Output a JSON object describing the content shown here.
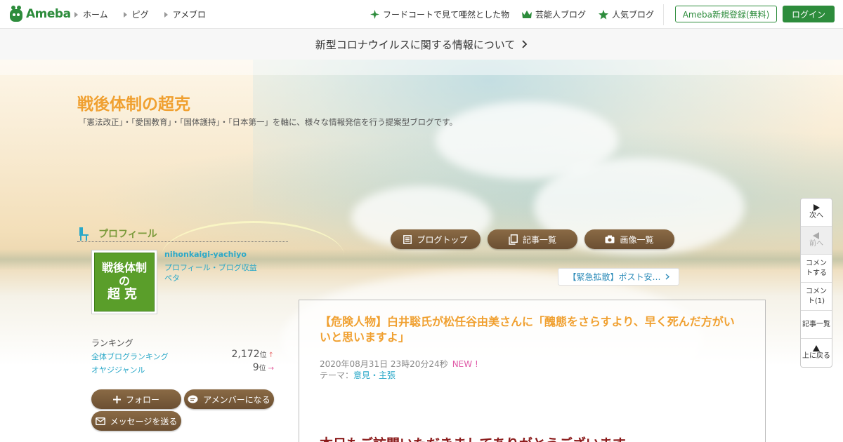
{
  "header": {
    "logo_text": "Ameba",
    "nav_left": [
      {
        "label": "ホーム"
      },
      {
        "label": "ピグ"
      },
      {
        "label": "アメブロ"
      }
    ],
    "nav_right": [
      {
        "label": "フードコートで見て唖然とした物",
        "icon": "sparkle-icon"
      },
      {
        "label": "芸能人ブログ",
        "icon": "crown-icon"
      },
      {
        "label": "人気ブログ",
        "icon": "star-icon"
      }
    ],
    "register_label": "Ameba新規登録(無料)",
    "login_label": "ログイン"
  },
  "notice": {
    "text": "新型コロナウイルスに関する情報について"
  },
  "blog": {
    "title": "戦後体制の超克",
    "description": "「憲法改正」・「愛国教育」・「国体護持」・「日本第一」を軸に、様々な情報発信を行う提案型ブログです。"
  },
  "profile": {
    "heading": "プロフィール",
    "avatar_lines": [
      "戦後体制",
      "の",
      "超克"
    ],
    "username": "nihonkaigi-yachiyo",
    "link1": "プロフィール・ブログ収益",
    "link2": "ペタ"
  },
  "ranking": {
    "title": "ランキング",
    "rows": [
      {
        "label": "全体ブログランキング",
        "value": "2,172",
        "unit": "位",
        "trend": "↑"
      },
      {
        "label": "オヤジジャンル",
        "value": "9",
        "unit": "位",
        "trend": "→"
      }
    ]
  },
  "profile_buttons": {
    "follow": "フォロー",
    "member": "アメンバーになる",
    "message": "メッセージを送る"
  },
  "blog_nav": {
    "top": "ブログトップ",
    "list": "記事一覧",
    "images": "画像一覧"
  },
  "related": {
    "label": "【緊急拡散】ポスト安…"
  },
  "entry": {
    "title": "【危険人物】白井聡氏が松任谷由美さんに「醜態をさらすより、早く死んだ方がいいと思いますよ」",
    "date": "2020年08月31日 23時20分24秒",
    "new_badge": "NEW !",
    "theme_prefix": "テーマ：",
    "theme": "意見・主張",
    "body_start": "本日もご訪問いただきましてありがとうございます。"
  },
  "float_nav": [
    {
      "label": "次へ",
      "icon": "play-right-icon"
    },
    {
      "label": "前へ",
      "icon": "play-left-icon",
      "disabled": true
    },
    {
      "label": "コメントする"
    },
    {
      "label": "コメント(1)"
    },
    {
      "label": "記事一覧"
    },
    {
      "label": "上に戻る",
      "icon": "triangle-up-icon"
    }
  ],
  "colors": {
    "brand_green": "#2d8c3c",
    "title_orange": "#f0a030",
    "link_cyan": "#2aa8c8",
    "button_brown": "#7a5c3c",
    "body_red": "#8b1a1a",
    "new_pink": "#e05aa8"
  }
}
